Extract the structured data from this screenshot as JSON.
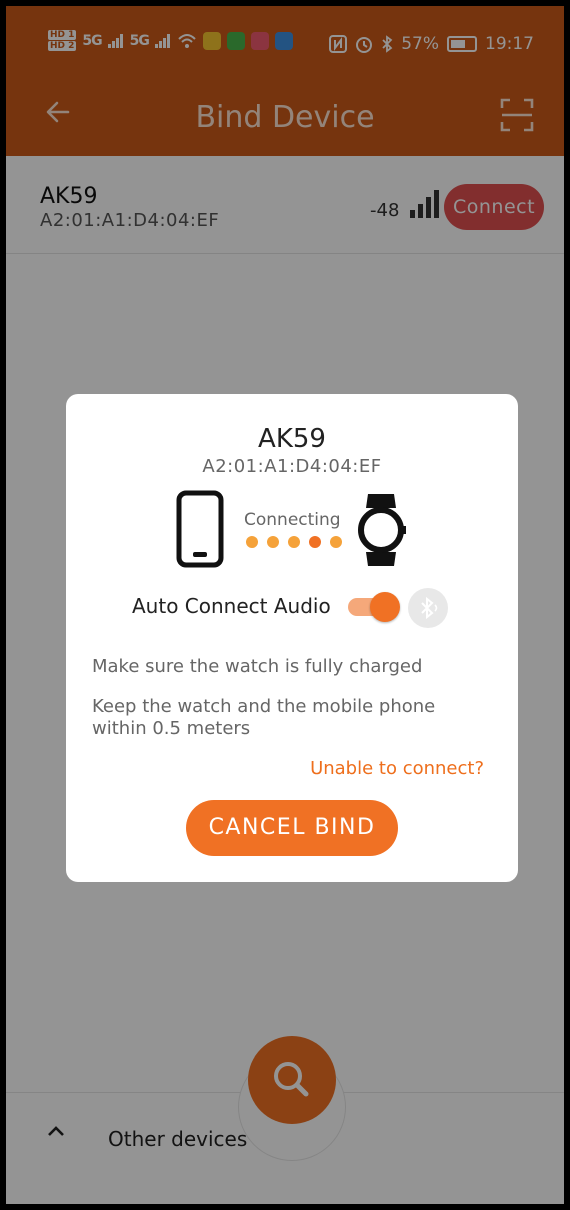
{
  "status_bar": {
    "hd1": "HD 1",
    "hd2": "HD 2",
    "signal1": "5G",
    "signal2": "5G",
    "battery_percent": "57%",
    "time": "19:17"
  },
  "app_bar": {
    "title": "Bind Device",
    "back_icon": "arrow-left-icon",
    "scan_icon": "scan-icon"
  },
  "device_list": [
    {
      "name": "AK59",
      "mac": "A2:01:A1:D4:04:EF",
      "rssi": "-48",
      "connect_label": "Connect"
    }
  ],
  "dialog": {
    "device_name": "AK59",
    "device_mac": "A2:01:A1:D4:04:EF",
    "status_text": "Connecting",
    "auto_connect_label": "Auto Connect Audio",
    "auto_connect_on": true,
    "tip1": "Make sure the watch is fully charged",
    "tip2": "Keep the watch and the mobile phone within 0.5 meters",
    "unable_link": "Unable to connect?",
    "cancel_label": "CANCEL BIND"
  },
  "bottom": {
    "other_devices_label": "Other devices",
    "search_icon": "search-icon"
  },
  "colors": {
    "header": "#cc5b19",
    "accent": "#f07124",
    "connect": "#e05050",
    "link": "#ee6f1d"
  }
}
